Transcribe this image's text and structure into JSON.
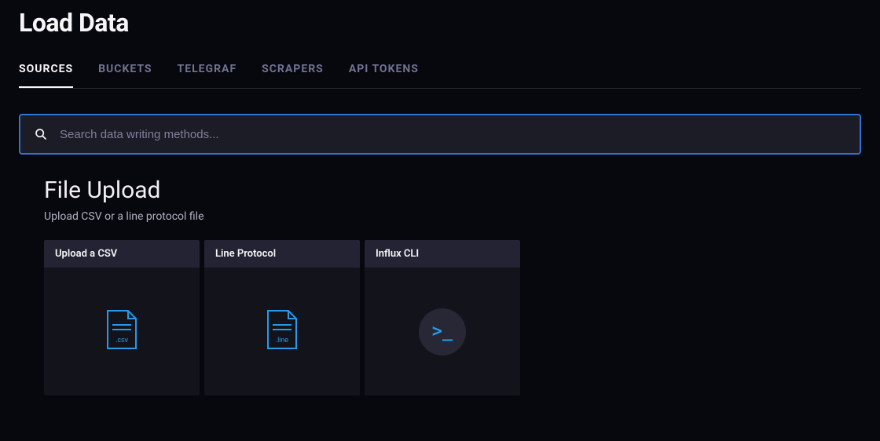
{
  "page": {
    "title": "Load Data"
  },
  "tabs": [
    {
      "label": "SOURCES",
      "active": true
    },
    {
      "label": "BUCKETS",
      "active": false
    },
    {
      "label": "TELEGRAF",
      "active": false
    },
    {
      "label": "SCRAPERS",
      "active": false
    },
    {
      "label": "API TOKENS",
      "active": false
    }
  ],
  "search": {
    "placeholder": "Search data writing methods...",
    "value": ""
  },
  "section": {
    "title": "File Upload",
    "subtitle": "Upload CSV or a line protocol file"
  },
  "cards": [
    {
      "title": "Upload a CSV",
      "icon": "csv-file-icon",
      "ext": ".csv"
    },
    {
      "title": "Line Protocol",
      "icon": "line-file-icon",
      "ext": ".line"
    },
    {
      "title": "Influx CLI",
      "icon": "cli-icon",
      "prompt": ">_"
    }
  ],
  "colors": {
    "accent": "#269ae9",
    "border_focus": "#2e74d1"
  }
}
